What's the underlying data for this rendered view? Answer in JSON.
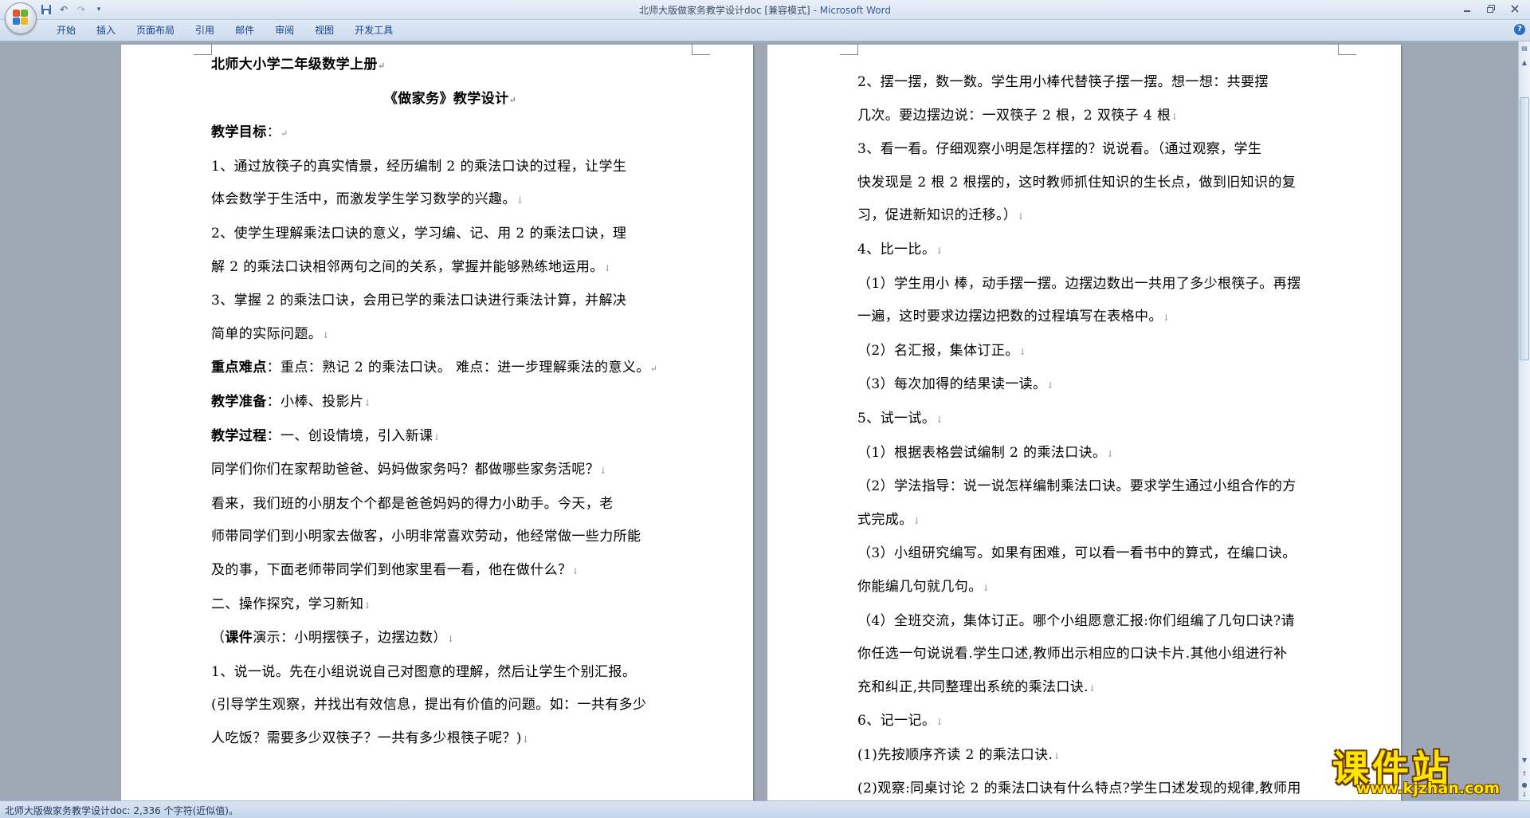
{
  "window": {
    "title": "北师大版做家务教学设计doc [兼容模式]",
    "title_separator": " - ",
    "app_name": "Microsoft Word"
  },
  "quick_access": {
    "save_icon": "save-icon",
    "undo_icon": "undo-icon",
    "redo_icon": "redo-icon",
    "customize_icon": "dropdown-icon"
  },
  "ribbon": {
    "tabs": [
      "开始",
      "插入",
      "页面布局",
      "引用",
      "邮件",
      "审阅",
      "视图",
      "开发工具"
    ],
    "help": "?"
  },
  "colors": {
    "accent": "#15428b",
    "app_background": "#9fa9b5",
    "watermark_fill": "#ffe600",
    "watermark_outline": "#6a3a00"
  },
  "pilcrow": "↓",
  "para_mark": "↵",
  "document": {
    "left_page": [
      {
        "text": "北师大小学二年级数学上册",
        "mark": "↵",
        "bold": true
      },
      {
        "text": "《做家务》教学设计",
        "mark": "↵",
        "bold": true,
        "center": true
      },
      {
        "label": "教学目标",
        "text": "：",
        "mark": "↵"
      },
      {
        "text": "      1、通过放筷子的真实情景，经历编制 2 的乘法口诀的过程，让学生"
      },
      {
        "text": "体会数学于生活中，而激发学生学习数学的兴趣。",
        "mark": "↓"
      },
      {
        "text": "      2、使学生理解乘法口诀的意义，学习编、记、用 2 的乘法口诀，理"
      },
      {
        "text": "解 2 的乘法口诀相邻两句之间的关系，掌握并能够熟练地运用。",
        "mark": "↓"
      },
      {
        "text": "      3、掌握 2 的乘法口诀，会用已学的乘法口诀进行乘法计算，并解决"
      },
      {
        "text": "简单的实际问题。",
        "mark": "↓"
      },
      {
        "label": "重点难点",
        "text": "：重点：熟记 2 的乘法口诀。   难点：进一步理解乘法的意义。",
        "mark": "↵"
      },
      {
        "label": "教学准备",
        "text": "：小棒、投影片",
        "mark": "↓"
      },
      {
        "label": "教学过程",
        "text": "：一、创设情境，引入新课",
        "mark": "↓"
      },
      {
        "text": "        同学们你们在家帮助爸爸、妈妈做家务吗？都做哪些家务活呢？",
        "mark": "↓"
      },
      {
        "text": "        看来，我们班的小朋友个个都是爸爸妈妈的得力小助手。今天，老"
      },
      {
        "text": "师带同学们到小明家去做客，小明非常喜欢劳动，他经常做一些力所能"
      },
      {
        "text": "及的事，下面老师带同学们到他家里看一看，他在做什么？",
        "mark": "↓"
      },
      {
        "text": "              二、操作探究，学习新知",
        "mark": "↓"
      },
      {
        "text": "              （",
        "label": "课件",
        "text2": "演示：小明摆筷子，边摆边数）",
        "mark": "↓"
      },
      {
        "text": "      1、说一说。先在小组说说自己对图意的理解，然后让学生个别汇报。"
      },
      {
        "text": "(引导学生观察，并找出有效信息，提出有价值的问题。如：一共有多少"
      },
      {
        "text": "人吃饭？需要多少双筷子？一共有多少根筷子呢？)",
        "mark": "↓"
      }
    ],
    "right_page": [
      {
        "text": "      2、摆一摆，数一数。学生用小棒代替筷子摆一摆。想一想：共要摆"
      },
      {
        "text": "几次。要边摆边说：一双筷子 2 根，2 双筷子 4 根",
        "mark": "↓"
      },
      {
        "text": "      3、看一看。仔细观察小明是怎样摆的？说说看。（通过观察，学生"
      },
      {
        "text": "快发现是 2 根 2 根摆的，这时教师抓住知识的生长点，做到旧知识的复"
      },
      {
        "text": "习，促进新知识的迁移。）",
        "mark": "↓"
      },
      {
        "text": "      4、比一比。",
        "mark": "↓"
      },
      {
        "text": "（1）学生用小 棒，动手摆一摆。边摆边数出一共用了多少根筷子。再摆"
      },
      {
        "text": "一遍，这时要求边摆边把数的过程填写在表格中。",
        "mark": "↓"
      },
      {
        "text": "（2）名汇报，集体订正。",
        "mark": "↓"
      },
      {
        "text": "（3）每次加得的结果读一读。",
        "mark": "↓"
      },
      {
        "text": "      5、试一试。",
        "mark": "↓"
      },
      {
        "text": "（1）根据表格尝试编制 2 的乘法口诀。",
        "mark": "↓"
      },
      {
        "text": "（2）学法指导：说一说怎样编制乘法口诀。要求学生通过小组合作的方"
      },
      {
        "text": "式完成。",
        "mark": "↓"
      },
      {
        "text": "（3）小组研究编写。如果有困难，可以看一看书中的算式，在编口诀。"
      },
      {
        "text": "你能编几句就几句。",
        "mark": "↓"
      },
      {
        "text": "（4）全班交流，集体订正。哪个小组愿意汇报:你们组编了几句口诀?请"
      },
      {
        "text": "你任选一句说说看.学生口述,教师出示相应的口诀卡片.其他小组进行补"
      },
      {
        "text": "充和纠正,共同整理出系统的乘法口诀.",
        "mark": "↓"
      },
      {
        "text": "    6、记一记。",
        "mark": "↓"
      },
      {
        "text": "(1)先按顺序齐读 2 的乘法口诀.",
        "mark": "↓"
      },
      {
        "text": "(2)观察:同桌讨论 2 的乘法口诀有什么特点?学生口述发现的规律,教师用"
      }
    ]
  },
  "statusbar": {
    "text": "北师大版做家务教学设计doc: 2,336 个字符(近似值)。"
  },
  "watermark": {
    "main": "课件站",
    "url": "www.kjzhan.com"
  }
}
